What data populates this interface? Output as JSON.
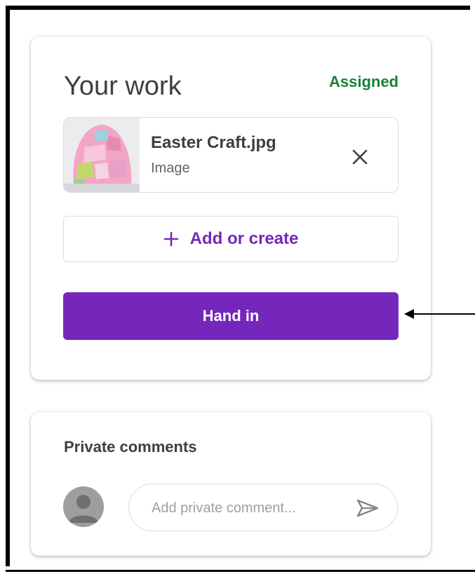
{
  "work": {
    "title": "Your work",
    "status": "Assigned",
    "attachment": {
      "name": "Easter Craft.jpg",
      "type": "Image",
      "thumbnail_icon": "easter-craft-thumbnail",
      "remove_icon": "close-icon"
    },
    "add_button": {
      "icon": "plus-icon",
      "label": "Add or create"
    },
    "hand_in_label": "Hand in"
  },
  "comments": {
    "title": "Private comments",
    "placeholder": "Add private comment...",
    "avatar_icon": "avatar-icon",
    "send_icon": "send-icon"
  },
  "colors": {
    "accent": "#7627bb",
    "status_green": "#188038",
    "text_primary": "#3c4043",
    "text_secondary": "#5f6368",
    "border": "#dadce0"
  }
}
